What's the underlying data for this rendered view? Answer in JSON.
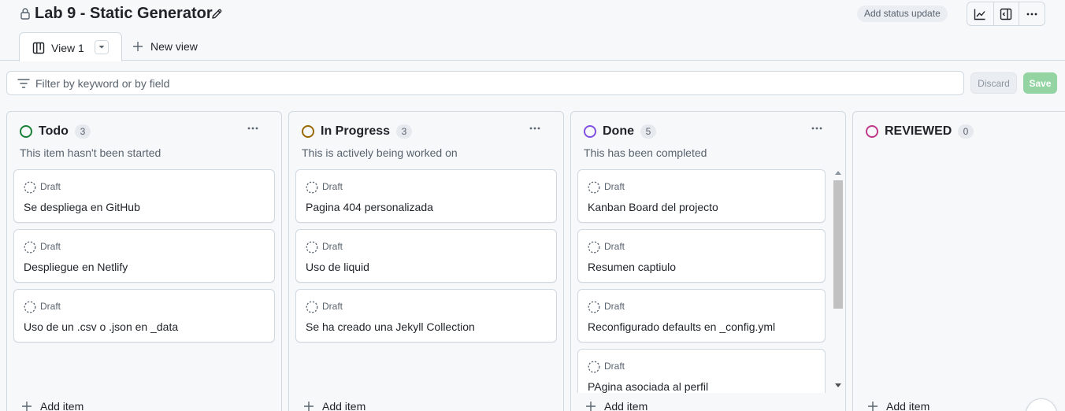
{
  "project": {
    "title": "Lab 9 - Static Generator",
    "status_button": "Add status update"
  },
  "toolbar": {
    "icons": [
      "insights-icon",
      "sidebar-icon",
      "more-icon"
    ]
  },
  "tabs": {
    "active": "View 1",
    "new_view": "New view"
  },
  "filter": {
    "placeholder": "Filter by keyword or by field",
    "discard_label": "Discard",
    "save_label": "Save"
  },
  "columns": [
    {
      "title": "Todo",
      "count": "3",
      "color": "#1a7f37",
      "description": "This item hasn't been started",
      "cards": [
        {
          "label": "Draft",
          "title": "Se despliega en GitHub"
        },
        {
          "label": "Draft",
          "title": "Despliegue en Netlify"
        },
        {
          "label": "Draft",
          "title": "Uso de un .csv o .json en _data"
        }
      ],
      "add_label": "Add item"
    },
    {
      "title": "In Progress",
      "count": "3",
      "color": "#9a6700",
      "description": "This is actively being worked on",
      "cards": [
        {
          "label": "Draft",
          "title": "Pagina 404 personalizada"
        },
        {
          "label": "Draft",
          "title": "Uso de liquid"
        },
        {
          "label": "Draft",
          "title": "Se ha creado una Jekyll Collection"
        }
      ],
      "add_label": "Add item"
    },
    {
      "title": "Done",
      "count": "5",
      "color": "#8250df",
      "description": "This has been completed",
      "cards": [
        {
          "label": "Draft",
          "title": "Kanban Board del projecto"
        },
        {
          "label": "Draft",
          "title": "Resumen captiulo"
        },
        {
          "label": "Draft",
          "title": "Reconfigurado defaults en _config.yml"
        },
        {
          "label": "Draft",
          "title": "PAgina asociada al perfil"
        }
      ],
      "add_label": "Add item"
    },
    {
      "title": "REVIEWED",
      "count": "0",
      "color": "#bf3989",
      "description": "",
      "cards": [],
      "add_label": "Add item"
    }
  ],
  "colors": {
    "accent_save": "#94d3a2",
    "border": "#d1d9e0",
    "background": "#f6f8fa"
  }
}
